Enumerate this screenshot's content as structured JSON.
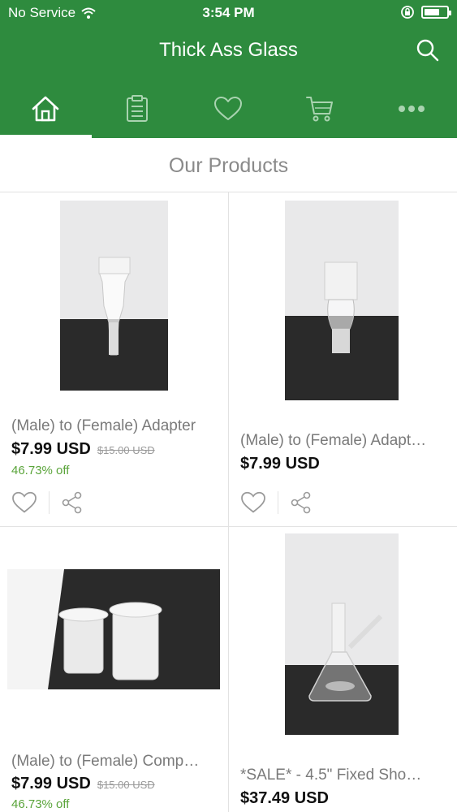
{
  "status_bar": {
    "carrier": "No Service",
    "time": "3:54 PM"
  },
  "header": {
    "title": "Thick Ass Glass"
  },
  "tabs": [
    {
      "icon": "home-icon",
      "active": true
    },
    {
      "icon": "clipboard-icon",
      "active": false
    },
    {
      "icon": "heart-icon",
      "active": false
    },
    {
      "icon": "cart-icon",
      "active": false
    },
    {
      "icon": "more-icon",
      "active": false
    }
  ],
  "section": {
    "title": "Our Products"
  },
  "colors": {
    "brand": "#2e8b3e",
    "discount": "#5aa43a"
  },
  "products": [
    {
      "name": "(Male) to (Female) Adapter",
      "price": "$7.99 USD",
      "old_price": "$15.00 USD",
      "discount": "46.73% off"
    },
    {
      "name": "(Male) to (Female) Adapt…",
      "price": "$7.99 USD"
    },
    {
      "name": "(Male) to (Female) Comp…",
      "price": "$7.99 USD",
      "old_price": "$15.00 USD",
      "discount": "46.73% off"
    },
    {
      "name": "*SALE* - 4.5\" Fixed Sho…",
      "price": "$37.49 USD"
    }
  ]
}
